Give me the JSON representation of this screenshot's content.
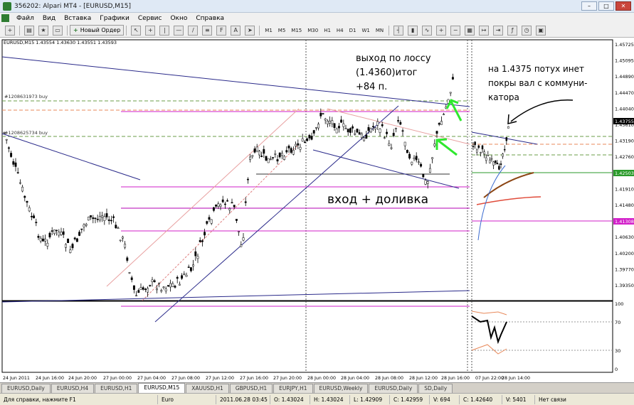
{
  "window": {
    "title": "356202: Alpari MT4 - [EURUSD,M15]",
    "minimize": "–",
    "maximize": "□",
    "close": "✕"
  },
  "menu": [
    "Файл",
    "Вид",
    "Вставка",
    "Графики",
    "Сервис",
    "Окно",
    "Справка"
  ],
  "toolbar": {
    "new_order": "Новый Ордер",
    "timeframes": [
      "M1",
      "M5",
      "M15",
      "M30",
      "H1",
      "H4",
      "D1",
      "W1",
      "MN"
    ]
  },
  "chart": {
    "symbol_label": "EURUSD,M15  1.43554 1.43630 1.43551 1.43593",
    "order_label_1": "#1208631973 buy",
    "order_label_2": "#1208625734 buy",
    "annotation_exit_1": "выход по лоссу",
    "annotation_exit_2": "(1.4360)итог",
    "annotation_exit_3": "+84 п.",
    "annotation_entry": "вход + доливка",
    "annotation_right_1": "на 1.4375 потух инет",
    "annotation_right_2": "покры вал с коммуни-",
    "annotation_right_3": "катора",
    "price_axis": [
      "1.45725",
      "1.45095",
      "1.44890",
      "1.44470",
      "1.44040",
      "1.43610",
      "1.43190",
      "1.42760",
      "1.42330",
      "1.41910",
      "1.41480",
      "1.41050",
      "1.40630",
      "1.40200",
      "1.39770",
      "1.39350"
    ],
    "price_tag_current": "1.43755",
    "price_tag_green": "1.42503",
    "price_tag_magenta": "1.41308",
    "osc_axis": [
      "100",
      "70",
      "30",
      "0"
    ],
    "time_axis": [
      "24 Jun 2011",
      "24 Jun 16:00",
      "24 Jun 20:00",
      "27 Jun 00:00",
      "27 Jun 04:00",
      "27 Jun 08:00",
      "27 Jun 12:00",
      "27 Jun 16:00",
      "27 Jun 20:00",
      "28 Jun 00:00",
      "28 Jun 04:00",
      "28 Jun 08:00",
      "28 Jun 12:00",
      "28 Jun 16:00",
      "07 Jun 22:00",
      "28 Jun 14:00"
    ]
  },
  "tabs": [
    "EURUSD,Daily",
    "EURUSD,H4",
    "EURUSD,H1",
    "EURUSD,M15",
    "XAUUSD,H1",
    "GBPUSD,H1",
    "EURJPY,H1",
    "EURUSD,Weekly",
    "EURUSD,Daily",
    "SD,Daily"
  ],
  "active_tab": "EURUSD,M15",
  "status": {
    "help": "Для справки, нажмите F1",
    "profile": "Euro",
    "datetime": "2011.06.28 03:45",
    "open": "O: 1.43024",
    "high": "H: 1.43024",
    "low": "L: 1.42909",
    "close": "C: 1.42959",
    "volume": "V: 694",
    "close2": "C: 1.42640",
    "volume2": "V: 5401",
    "connection": "Нет связи"
  }
}
